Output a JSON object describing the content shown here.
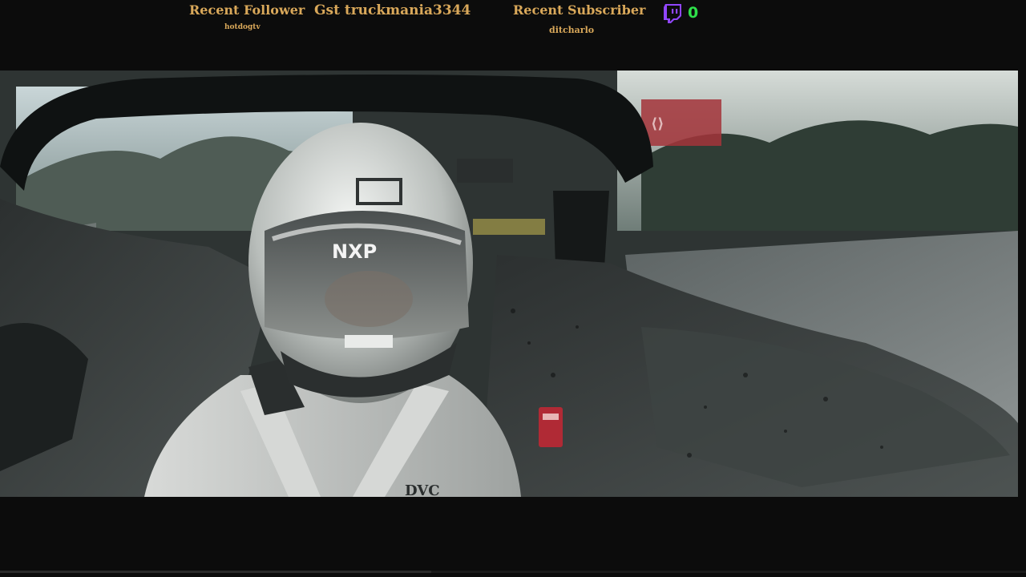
{
  "stream_overlay": {
    "recent_follower_label": "Recent Follower",
    "recent_follower_name": "hotdogtv",
    "guest_label": "Gst truckmania3344",
    "recent_subscriber_label": "Recent Subscriber",
    "recent_subscriber_name": "ditcharlo",
    "viewer_count": "0",
    "twitch_icon": "twitch-icon",
    "colors": {
      "overlay_text": "#d9a85a",
      "viewer_count": "#2ee04a",
      "twitch_purple": "#9146ff"
    }
  },
  "video": {
    "scene": "onboard-cockpit-driver-helmet",
    "helmet_text": "NXP",
    "sponsor_text": "DVC",
    "progress": 0.42
  }
}
